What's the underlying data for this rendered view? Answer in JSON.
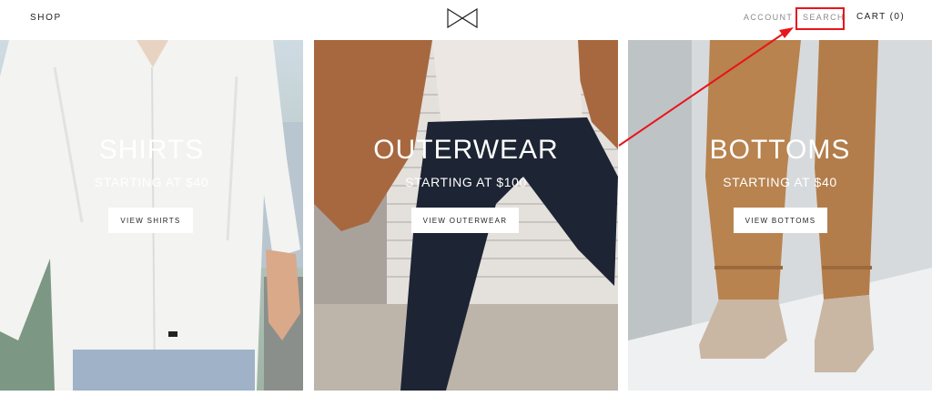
{
  "header": {
    "shop_label": "SHOP",
    "account_label": "ACCOUNT",
    "search_label": "SEARCH",
    "cart_label": "CART (0)",
    "logo_icon": "bowtie-logo-icon"
  },
  "annotation": {
    "highlight_color": "#e8151b"
  },
  "panels": [
    {
      "title": "SHIRTS",
      "subtitle": "STARTING AT $40",
      "button": "VIEW SHIRTS"
    },
    {
      "title": "OUTERWEAR",
      "subtitle": "STARTING AT $100",
      "button": "VIEW OUTERWEAR"
    },
    {
      "title": "BOTTOMS",
      "subtitle": "STARTING AT $40",
      "button": "VIEW BOTTOMS"
    }
  ]
}
